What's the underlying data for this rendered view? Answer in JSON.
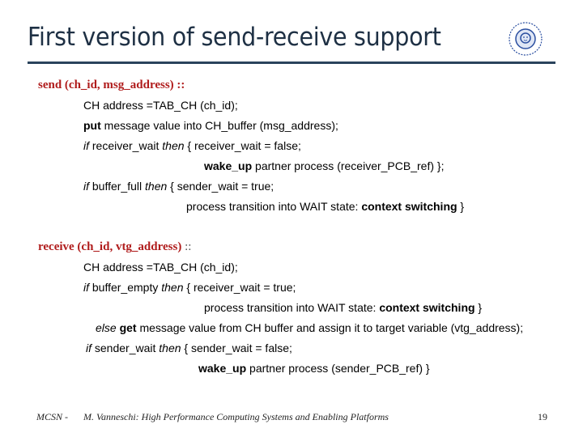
{
  "slide": {
    "title": "First version of send-receive support",
    "logo_icon": "university-seal-icon",
    "send": {
      "header": "send (ch_id, msg_address) ::",
      "l1": "CH address =TAB_CH (ch_id);",
      "l2_kw": "put",
      "l2_rest": " message value into CH_buffer (msg_address);",
      "l3_if": "if",
      "l3_cond": " receiver_wait ",
      "l3_then": "then",
      "l3_rest": " {  receiver_wait = false;",
      "l4_kw": "wake_up",
      "l4_rest": " partner process (receiver_PCB_ref) };",
      "l5_if": "if",
      "l5_cond": " buffer_full ",
      "l5_then": "then",
      "l5_rest": " {  sender_wait = true;",
      "l6_pre": "process transition into WAIT state: ",
      "l6_kw": "context switching",
      "l6_post": " }"
    },
    "receive": {
      "header": "receive (ch_id, vtg_address)",
      "header_suffix": " ::",
      "l1": "CH address =TAB_CH (ch_id);",
      "l2_if": "if",
      "l2_cond": " buffer_empty ",
      "l2_then": "then",
      "l2_rest": " {  receiver_wait = true;",
      "l3_pre": "process transition into WAIT state: ",
      "l3_kw": "context switching",
      "l3_post": " }",
      "l4_else": "else",
      "l4_kw": " get",
      "l4_rest": " message value from CH buffer and assign it to target variable (vtg_address);",
      "l5_if": "if",
      "l5_cond": " sender_wait ",
      "l5_then": "then",
      "l5_rest": " {  sender_wait = false;",
      "l6_kw": "wake_up",
      "l6_rest": " partner process (sender_PCB_ref) }"
    },
    "footer": {
      "left": "MCSN  -",
      "center": "M. Vanneschi: High Performance Computing Systems and Enabling Platforms",
      "page": "19"
    }
  }
}
